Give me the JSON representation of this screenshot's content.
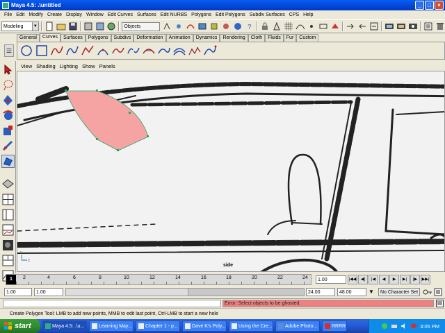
{
  "window": {
    "title": "Maya 4.5: .\\untitled",
    "buttons": {
      "minimize": "_",
      "maximize": "□",
      "close": "×"
    }
  },
  "menubar": [
    "File",
    "Edit",
    "Modify",
    "Create",
    "Display",
    "Window",
    "Edit Curves",
    "Surfaces",
    "Edit NURBS",
    "Polygons",
    "Edit Polygons",
    "Subdiv Surfaces",
    "CPS",
    "Help"
  ],
  "status_line": {
    "mode": "Modeling",
    "selection_field": "Objects"
  },
  "shelf": {
    "tabs": [
      "General",
      "Curves",
      "Surfaces",
      "Polygons",
      "Subdivs",
      "Deformation",
      "Animation",
      "Dynamics",
      "Rendering",
      "Cloth",
      "Fluids",
      "Fur",
      "Custom"
    ],
    "active_tab": "Curves"
  },
  "panel_menu": [
    "View",
    "Shading",
    "Lighting",
    "Show",
    "Panels"
  ],
  "viewport": {
    "camera_label": "side",
    "axis_labels": {
      "z": "Z",
      "y": "Y"
    }
  },
  "timeline": {
    "ticks": [
      "1",
      "2",
      "4",
      "6",
      "8",
      "10",
      "12",
      "14",
      "16",
      "18",
      "20",
      "22",
      "24"
    ],
    "current_frame": "1.00"
  },
  "range": {
    "start": "1.00",
    "playback_start": "1.00",
    "playback_end": "24.00",
    "end": "48.00",
    "character_set": "No Character Set"
  },
  "command_line": {
    "result": "Error: Select objects to be ghosted."
  },
  "help_line": "Create Polygon Tool: LMB to add new points, MMB to edit last point, Ctrl-LMB to start a new hole",
  "taskbar": {
    "start_label": "start",
    "buttons": [
      "Maya 4.5: .\\u...",
      "Learning May...",
      "Chapter 1 - p...",
      "Dave K's Poly...",
      "Using the Cre...",
      "Adobe Photo...",
      "RRRR"
    ],
    "clock": "3:05 PM"
  },
  "colors": {
    "polygon_fill": "#f5a3a3",
    "polygon_vertex": "#2aa56a",
    "error_bg": "#f08080",
    "title_bar": "#0a5ef0",
    "taskbar": "#245edb",
    "start_button": "#2f8f2f"
  }
}
